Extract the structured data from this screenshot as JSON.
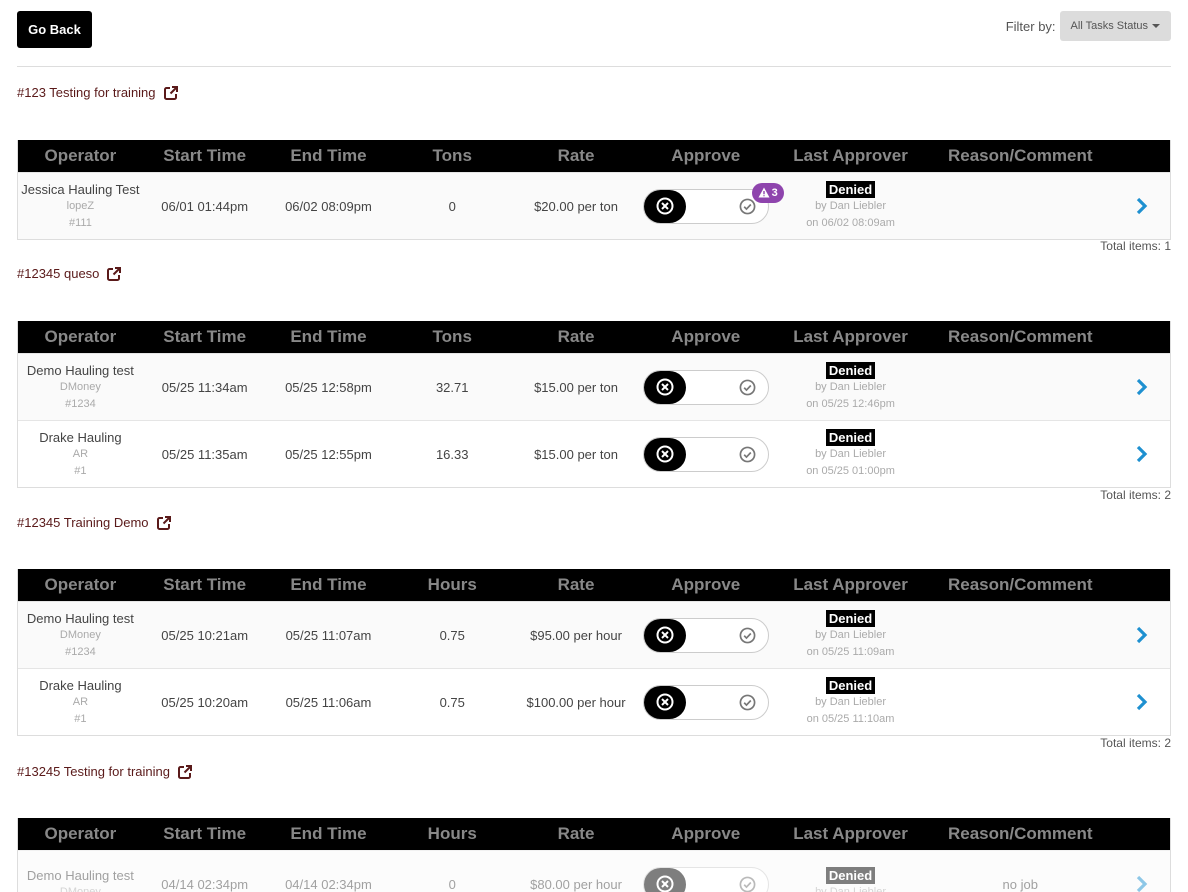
{
  "toolbar": {
    "go_back_label": "Go Back",
    "filter_label": "Filter by:",
    "filter_value": "All Tasks Status"
  },
  "columns": {
    "operator": "Operator",
    "start_time": "Start Time",
    "end_time": "End Time",
    "tons": "Tons",
    "hours": "Hours",
    "rate": "Rate",
    "approve": "Approve",
    "last_approver": "Last Approver",
    "reason": "Reason/Comment"
  },
  "sections": [
    {
      "title": "#123 Testing for training",
      "qty_header": "Tons",
      "total": "Total items: 1",
      "rows": [
        {
          "name": "Jessica Hauling Test",
          "sub1": "lopeZ",
          "sub2": "#111",
          "start": "06/01 01:44pm",
          "end": "06/02 08:09pm",
          "qty": "0",
          "rate": "$20.00 per ton",
          "status": "Denied",
          "by": "by Dan Liebler",
          "on": "on 06/02 08:09am",
          "reason": "",
          "warn_count": "3"
        }
      ]
    },
    {
      "title": "#12345 queso",
      "qty_header": "Tons",
      "total": "Total items: 2",
      "rows": [
        {
          "name": "Demo Hauling test",
          "sub1": "DMoney",
          "sub2": "#1234",
          "start": "05/25 11:34am",
          "end": "05/25 12:58pm",
          "qty": "32.71",
          "rate": "$15.00 per ton",
          "status": "Denied",
          "by": "by Dan Liebler",
          "on": "on 05/25 12:46pm",
          "reason": ""
        },
        {
          "name": "Drake Hauling",
          "sub1": "AR",
          "sub2": "#1",
          "start": "05/25 11:35am",
          "end": "05/25 12:55pm",
          "qty": "16.33",
          "rate": "$15.00 per ton",
          "status": "Denied",
          "by": "by Dan Liebler",
          "on": "on 05/25 01:00pm",
          "reason": ""
        }
      ]
    },
    {
      "title": "#12345 Training Demo",
      "qty_header": "Hours",
      "total": "Total items: 2",
      "rows": [
        {
          "name": "Demo Hauling test",
          "sub1": "DMoney",
          "sub2": "#1234",
          "start": "05/25 10:21am",
          "end": "05/25 11:07am",
          "qty": "0.75",
          "rate": "$95.00 per hour",
          "status": "Denied",
          "by": "by Dan Liebler",
          "on": "on 05/25 11:09am",
          "reason": ""
        },
        {
          "name": "Drake Hauling",
          "sub1": "AR",
          "sub2": "#1",
          "start": "05/25 10:20am",
          "end": "05/25 11:06am",
          "qty": "0.75",
          "rate": "$100.00 per hour",
          "status": "Denied",
          "by": "by Dan Liebler",
          "on": "on 05/25 11:10am",
          "reason": ""
        }
      ]
    },
    {
      "title": "#13245 Testing for training",
      "qty_header": "Hours",
      "total": "",
      "rows": [
        {
          "name": "Demo Hauling test",
          "sub1": "DMoney",
          "sub2": "",
          "start": "04/14 02:34pm",
          "end": "04/14 02:34pm",
          "qty": "0",
          "rate": "$80.00 per hour",
          "status": "Denied",
          "by": "by Dan Liebler",
          "on": "",
          "reason": "no job"
        }
      ]
    }
  ]
}
